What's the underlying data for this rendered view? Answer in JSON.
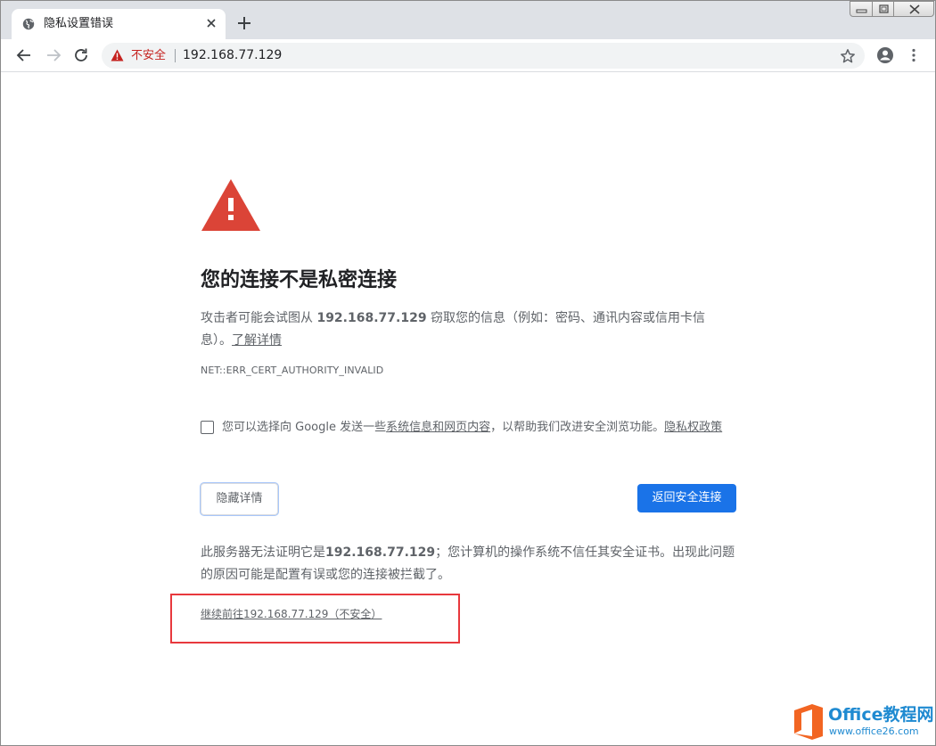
{
  "browser": {
    "tab": {
      "title": "隐私设置错误",
      "close_glyph": "✕"
    },
    "new_tab_glyph": "+",
    "window_controls": [
      "minimize",
      "maximize",
      "close"
    ],
    "omnibox": {
      "security_label": "不安全",
      "url": "192.168.77.129"
    }
  },
  "interstitial": {
    "title": "您的连接不是私密连接",
    "message_prefix": "攻击者可能会试图从 ",
    "message_host": "192.168.77.129",
    "message_suffix": " 窃取您的信息（例如：密码、通讯内容或信用卡信息）。",
    "learn_more": "了解详情",
    "error_code": "NET::ERR_CERT_AUTHORITY_INVALID",
    "sbr_prefix": "您可以选择向 Google 发送一些",
    "sbr_link": "系统信息和网页内容",
    "sbr_middle": "，以帮助我们改进安全浏览功能。",
    "sbr_privacy": "隐私权政策",
    "details_button": "隐藏详情",
    "primary_button": "返回安全连接",
    "details_prefix": "此服务器无法证明它是",
    "details_host": "192.168.77.129",
    "details_suffix": "；您计算机的操作系统不信任其安全证书。出现此问题的原因可能是配置有误或您的连接被拦截了。",
    "proceed_link": "继续前往192.168.77.129（不安全）"
  },
  "watermark": {
    "name": "Office教程网",
    "url": "www.office26.com"
  },
  "colors": {
    "danger_red": "#db4437",
    "insecure_text": "#c5221f",
    "primary_blue": "#1a73e8",
    "highlight_red": "#e8383d",
    "watermark_orange": "#f26522",
    "watermark_blue": "#1f8ad1"
  },
  "icons": [
    "globe-icon",
    "close-icon",
    "plus-icon",
    "back-arrow-icon",
    "forward-arrow-icon",
    "reload-icon",
    "warning-triangle-icon",
    "star-icon",
    "account-circle-icon",
    "more-vert-icon",
    "danger-triangle-icon",
    "office-logo-icon"
  ]
}
